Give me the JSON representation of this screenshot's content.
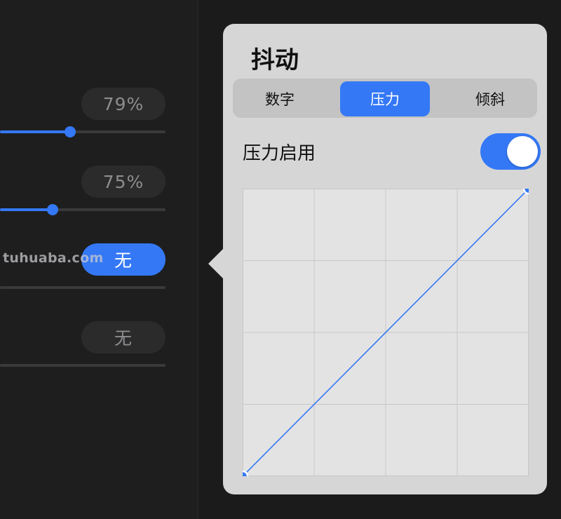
{
  "left_controls": [
    {
      "label": "79%",
      "slider_fraction": 0.42,
      "active": false
    },
    {
      "label": "75%",
      "slider_fraction": 0.32,
      "active": false
    },
    {
      "label": "无",
      "active": true
    },
    {
      "label": "无",
      "active": false
    }
  ],
  "watermark": "tuhuaba.com",
  "popover": {
    "title": "抖动",
    "tabs": [
      {
        "label": "数字",
        "selected": false
      },
      {
        "label": "压力",
        "selected": true
      },
      {
        "label": "倾斜",
        "selected": false
      }
    ],
    "pressure_toggle": {
      "label": "压力启用",
      "on": true
    },
    "curve": {
      "grid_divisions": 4,
      "points": [
        [
          0,
          0
        ],
        [
          1,
          1
        ]
      ]
    }
  },
  "colors": {
    "accent": "#3478f6",
    "popover_bg": "#d6d6d6",
    "graph_bg": "#e3e3e3",
    "grid_line": "#c8c8c8",
    "app_bg": "#1e1e1f"
  }
}
